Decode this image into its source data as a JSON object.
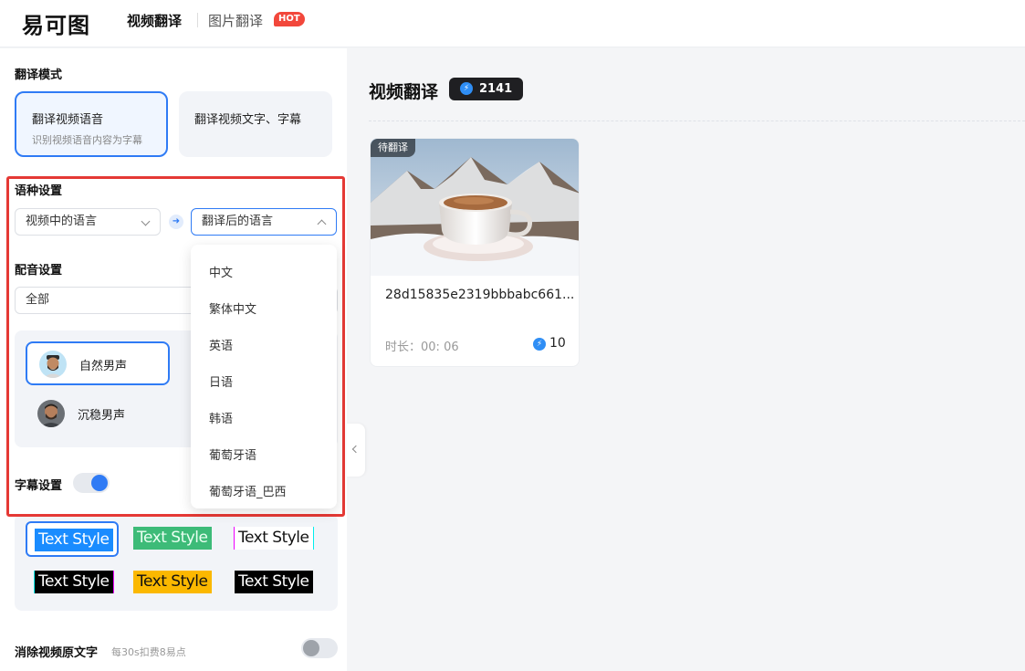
{
  "header": {
    "logo": "易可图",
    "nav": {
      "active": "视频翻译",
      "other": "图片翻译",
      "hot_badge": "HOT"
    }
  },
  "left": {
    "mode": {
      "title": "翻译模式",
      "options": [
        {
          "title": "翻译视频语音",
          "subtitle": "识别视频语音内容为字幕",
          "selected": true
        },
        {
          "title": "翻译视频文字、字幕",
          "selected": false
        }
      ]
    },
    "language": {
      "title": "语种设置",
      "source_placeholder": "视频中的语言",
      "target_placeholder": "翻译后的语言",
      "target_options": [
        "中文",
        "繁体中文",
        "英语",
        "日语",
        "韩语",
        "葡萄牙语",
        "葡萄牙语_巴西"
      ]
    },
    "dubbing": {
      "title": "配音设置",
      "filter_value": "全部",
      "voices": [
        {
          "label": "自然男声",
          "selected": true
        },
        {
          "label": "沉稳男声",
          "selected": false
        }
      ]
    },
    "subtitle": {
      "title": "字幕设置",
      "enabled": true,
      "styles": [
        "Text Style",
        "Text Style",
        "Text Style",
        "Text Style",
        "Text Style",
        "Text Style"
      ]
    },
    "erase": {
      "title": "消除视频原文字",
      "note": "每30s扣费8易点",
      "enabled": false
    }
  },
  "main": {
    "title": "视频翻译",
    "credits": "2141",
    "videos": [
      {
        "status": "待翻译",
        "name": "28d15835e2319bbbabc661...",
        "duration_label": "时长：",
        "duration": "00: 06",
        "cost": "10"
      }
    ]
  },
  "colors": {
    "accent": "#2f7bf5",
    "highlight": "#e53935",
    "hot": "#f2473b",
    "toggle_on": "#2f7bf5",
    "toggle_off": "#9ea3aa"
  }
}
